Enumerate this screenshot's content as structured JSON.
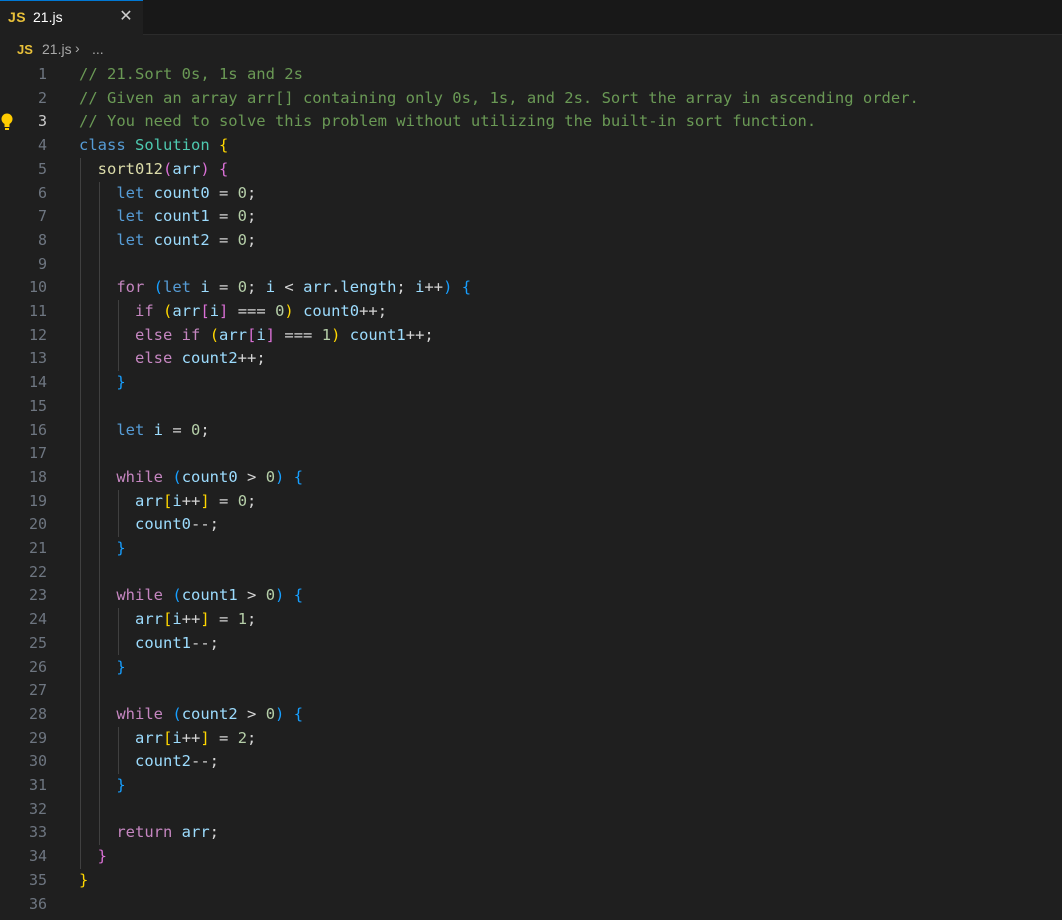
{
  "tab": {
    "badge": "JS",
    "filename": "21.js",
    "close_glyph": "✕"
  },
  "breadcrumb": {
    "badge": "JS",
    "filename": "21.js",
    "chevron": "›",
    "more": "..."
  },
  "editor": {
    "active_line": 3,
    "lines": [
      [
        [
          "c",
          "// 21.Sort 0s, 1s and 2s"
        ]
      ],
      [
        [
          "c",
          "// Given an array arr[] containing only 0s, 1s, and 2s. Sort the array in ascending order."
        ]
      ],
      [
        [
          "c",
          "// You need to solve this problem without utilizing the built-in sort function."
        ]
      ],
      [
        [
          "k",
          "class"
        ],
        [
          "p",
          " "
        ],
        [
          "cls",
          "Solution"
        ],
        [
          "p",
          " "
        ],
        [
          "b1",
          "{"
        ]
      ],
      [
        [
          "p",
          "  "
        ],
        [
          "fn",
          "sort012"
        ],
        [
          "b2",
          "("
        ],
        [
          "v",
          "arr"
        ],
        [
          "b2",
          ")"
        ],
        [
          "p",
          " "
        ],
        [
          "b2",
          "{"
        ]
      ],
      [
        [
          "p",
          "    "
        ],
        [
          "k",
          "let"
        ],
        [
          "p",
          " "
        ],
        [
          "v",
          "count0"
        ],
        [
          "p",
          " = "
        ],
        [
          "n",
          "0"
        ],
        [
          "p",
          ";"
        ]
      ],
      [
        [
          "p",
          "    "
        ],
        [
          "k",
          "let"
        ],
        [
          "p",
          " "
        ],
        [
          "v",
          "count1"
        ],
        [
          "p",
          " = "
        ],
        [
          "n",
          "0"
        ],
        [
          "p",
          ";"
        ]
      ],
      [
        [
          "p",
          "    "
        ],
        [
          "k",
          "let"
        ],
        [
          "p",
          " "
        ],
        [
          "v",
          "count2"
        ],
        [
          "p",
          " = "
        ],
        [
          "n",
          "0"
        ],
        [
          "p",
          ";"
        ]
      ],
      [],
      [
        [
          "p",
          "    "
        ],
        [
          "ctl",
          "for"
        ],
        [
          "p",
          " "
        ],
        [
          "b3",
          "("
        ],
        [
          "k",
          "let"
        ],
        [
          "p",
          " "
        ],
        [
          "v",
          "i"
        ],
        [
          "p",
          " = "
        ],
        [
          "n",
          "0"
        ],
        [
          "p",
          "; "
        ],
        [
          "v",
          "i"
        ],
        [
          "p",
          " < "
        ],
        [
          "v",
          "arr"
        ],
        [
          "p",
          "."
        ],
        [
          "v",
          "length"
        ],
        [
          "p",
          "; "
        ],
        [
          "v",
          "i"
        ],
        [
          "p",
          "++"
        ],
        [
          "b3",
          ")"
        ],
        [
          "p",
          " "
        ],
        [
          "b3",
          "{"
        ]
      ],
      [
        [
          "p",
          "      "
        ],
        [
          "ctl",
          "if"
        ],
        [
          "p",
          " "
        ],
        [
          "b1",
          "("
        ],
        [
          "v",
          "arr"
        ],
        [
          "b2",
          "["
        ],
        [
          "v",
          "i"
        ],
        [
          "b2",
          "]"
        ],
        [
          "p",
          " === "
        ],
        [
          "n",
          "0"
        ],
        [
          "b1",
          ")"
        ],
        [
          "p",
          " "
        ],
        [
          "v",
          "count0"
        ],
        [
          "p",
          "++;"
        ]
      ],
      [
        [
          "p",
          "      "
        ],
        [
          "ctl",
          "else"
        ],
        [
          "p",
          " "
        ],
        [
          "ctl",
          "if"
        ],
        [
          "p",
          " "
        ],
        [
          "b1",
          "("
        ],
        [
          "v",
          "arr"
        ],
        [
          "b2",
          "["
        ],
        [
          "v",
          "i"
        ],
        [
          "b2",
          "]"
        ],
        [
          "p",
          " === "
        ],
        [
          "n",
          "1"
        ],
        [
          "b1",
          ")"
        ],
        [
          "p",
          " "
        ],
        [
          "v",
          "count1"
        ],
        [
          "p",
          "++;"
        ]
      ],
      [
        [
          "p",
          "      "
        ],
        [
          "ctl",
          "else"
        ],
        [
          "p",
          " "
        ],
        [
          "v",
          "count2"
        ],
        [
          "p",
          "++;"
        ]
      ],
      [
        [
          "p",
          "    "
        ],
        [
          "b3",
          "}"
        ]
      ],
      [],
      [
        [
          "p",
          "    "
        ],
        [
          "k",
          "let"
        ],
        [
          "p",
          " "
        ],
        [
          "v",
          "i"
        ],
        [
          "p",
          " = "
        ],
        [
          "n",
          "0"
        ],
        [
          "p",
          ";"
        ]
      ],
      [],
      [
        [
          "p",
          "    "
        ],
        [
          "ctl",
          "while"
        ],
        [
          "p",
          " "
        ],
        [
          "b3",
          "("
        ],
        [
          "v",
          "count0"
        ],
        [
          "p",
          " > "
        ],
        [
          "n",
          "0"
        ],
        [
          "b3",
          ")"
        ],
        [
          "p",
          " "
        ],
        [
          "b3",
          "{"
        ]
      ],
      [
        [
          "p",
          "      "
        ],
        [
          "v",
          "arr"
        ],
        [
          "b1",
          "["
        ],
        [
          "v",
          "i"
        ],
        [
          "p",
          "++"
        ],
        [
          "b1",
          "]"
        ],
        [
          "p",
          " = "
        ],
        [
          "n",
          "0"
        ],
        [
          "p",
          ";"
        ]
      ],
      [
        [
          "p",
          "      "
        ],
        [
          "v",
          "count0"
        ],
        [
          "p",
          "--;"
        ]
      ],
      [
        [
          "p",
          "    "
        ],
        [
          "b3",
          "}"
        ]
      ],
      [],
      [
        [
          "p",
          "    "
        ],
        [
          "ctl",
          "while"
        ],
        [
          "p",
          " "
        ],
        [
          "b3",
          "("
        ],
        [
          "v",
          "count1"
        ],
        [
          "p",
          " > "
        ],
        [
          "n",
          "0"
        ],
        [
          "b3",
          ")"
        ],
        [
          "p",
          " "
        ],
        [
          "b3",
          "{"
        ]
      ],
      [
        [
          "p",
          "      "
        ],
        [
          "v",
          "arr"
        ],
        [
          "b1",
          "["
        ],
        [
          "v",
          "i"
        ],
        [
          "p",
          "++"
        ],
        [
          "b1",
          "]"
        ],
        [
          "p",
          " = "
        ],
        [
          "n",
          "1"
        ],
        [
          "p",
          ";"
        ]
      ],
      [
        [
          "p",
          "      "
        ],
        [
          "v",
          "count1"
        ],
        [
          "p",
          "--;"
        ]
      ],
      [
        [
          "p",
          "    "
        ],
        [
          "b3",
          "}"
        ]
      ],
      [],
      [
        [
          "p",
          "    "
        ],
        [
          "ctl",
          "while"
        ],
        [
          "p",
          " "
        ],
        [
          "b3",
          "("
        ],
        [
          "v",
          "count2"
        ],
        [
          "p",
          " > "
        ],
        [
          "n",
          "0"
        ],
        [
          "b3",
          ")"
        ],
        [
          "p",
          " "
        ],
        [
          "b3",
          "{"
        ]
      ],
      [
        [
          "p",
          "      "
        ],
        [
          "v",
          "arr"
        ],
        [
          "b1",
          "["
        ],
        [
          "v",
          "i"
        ],
        [
          "p",
          "++"
        ],
        [
          "b1",
          "]"
        ],
        [
          "p",
          " = "
        ],
        [
          "n",
          "2"
        ],
        [
          "p",
          ";"
        ]
      ],
      [
        [
          "p",
          "      "
        ],
        [
          "v",
          "count2"
        ],
        [
          "p",
          "--;"
        ]
      ],
      [
        [
          "p",
          "    "
        ],
        [
          "b3",
          "}"
        ]
      ],
      [],
      [
        [
          "p",
          "    "
        ],
        [
          "ctl",
          "return"
        ],
        [
          "p",
          " "
        ],
        [
          "v",
          "arr"
        ],
        [
          "p",
          ";"
        ]
      ],
      [
        [
          "p",
          "  "
        ],
        [
          "b2",
          "}"
        ]
      ],
      [
        [
          "b1",
          "}"
        ]
      ],
      []
    ]
  }
}
